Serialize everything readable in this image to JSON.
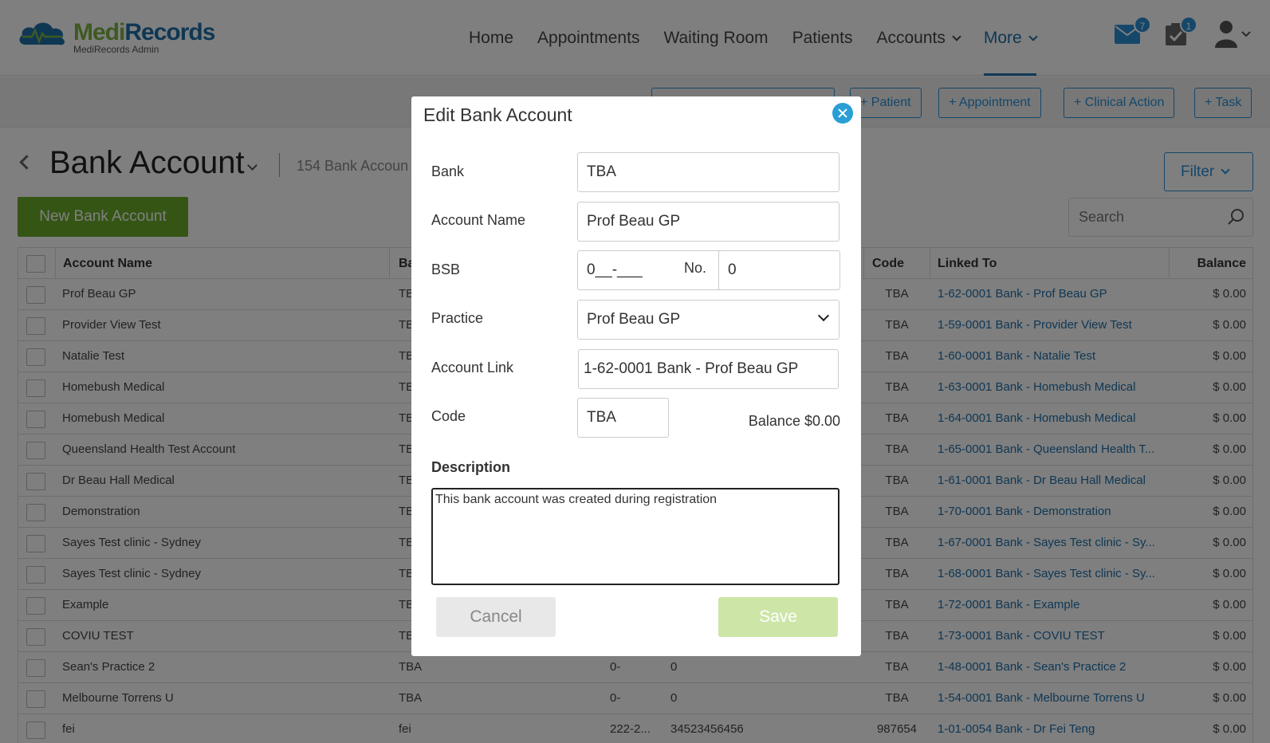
{
  "brand": {
    "name_part1": "Medi",
    "name_part2": "Records",
    "subtitle": "MediRecords Admin"
  },
  "nav": {
    "home": "Home",
    "appointments": "Appointments",
    "waiting_room": "Waiting Room",
    "patients": "Patients",
    "accounts": "Accounts",
    "more": "More",
    "messages_badge": "7",
    "tasks_badge": "1"
  },
  "quick_actions": {
    "patient": "+ Patient",
    "appointment": "+ Appointment",
    "clinical_action": "+ Clinical Action",
    "task": "+ Task"
  },
  "page": {
    "title": "Bank Account",
    "count": "154 Bank Accoun",
    "new_button": "New Bank Account",
    "filter_button": "Filter",
    "search_placeholder": "Search"
  },
  "table": {
    "headers": {
      "account_name": "Account Name",
      "bank": "Ba",
      "code": "Code",
      "linked_to": "Linked To",
      "balance": "Balance"
    },
    "rows": [
      {
        "name": "Prof Beau GP",
        "bank": "TB",
        "bsb": "",
        "no": "",
        "code": "TBA",
        "linked": "1-62-0001 Bank - Prof Beau GP",
        "balance": "$ 0.00"
      },
      {
        "name": "Provider View Test",
        "bank": "TB",
        "bsb": "",
        "no": "",
        "code": "TBA",
        "linked": "1-59-0001 Bank - Provider View Test",
        "balance": "$ 0.00"
      },
      {
        "name": "Natalie Test",
        "bank": "TB",
        "bsb": "",
        "no": "",
        "code": "TBA",
        "linked": "1-60-0001 Bank - Natalie Test",
        "balance": "$ 0.00"
      },
      {
        "name": "Homebush Medical",
        "bank": "TB",
        "bsb": "",
        "no": "",
        "code": "TBA",
        "linked": "1-63-0001 Bank - Homebush Medical",
        "balance": "$ 0.00"
      },
      {
        "name": "Homebush Medical",
        "bank": "TB",
        "bsb": "",
        "no": "",
        "code": "TBA",
        "linked": "1-64-0001 Bank - Homebush Medical",
        "balance": "$ 0.00"
      },
      {
        "name": "Queensland Health Test Account",
        "bank": "TB",
        "bsb": "",
        "no": "",
        "code": "TBA",
        "linked": "1-65-0001 Bank - Queensland Health T...",
        "balance": "$ 0.00"
      },
      {
        "name": "Dr Beau Hall Medical",
        "bank": "TB",
        "bsb": "",
        "no": "",
        "code": "TBA",
        "linked": "1-61-0001 Bank - Dr Beau Hall Medical",
        "balance": "$ 0.00"
      },
      {
        "name": "Demonstration",
        "bank": "TB",
        "bsb": "",
        "no": "",
        "code": "TBA",
        "linked": "1-70-0001 Bank - Demonstration",
        "balance": "$ 0.00"
      },
      {
        "name": "Sayes Test clinic - Sydney",
        "bank": "TB",
        "bsb": "",
        "no": "",
        "code": "TBA",
        "linked": "1-67-0001 Bank - Sayes Test clinic - Sy...",
        "balance": "$ 0.00"
      },
      {
        "name": "Sayes Test clinic - Sydney",
        "bank": "TB",
        "bsb": "",
        "no": "",
        "code": "TBA",
        "linked": "1-68-0001 Bank - Sayes Test clinic - Sy...",
        "balance": "$ 0.00"
      },
      {
        "name": "Example",
        "bank": "TB",
        "bsb": "",
        "no": "",
        "code": "TBA",
        "linked": "1-72-0001 Bank - Example",
        "balance": "$ 0.00"
      },
      {
        "name": "COVIU TEST",
        "bank": "TB",
        "bsb": "",
        "no": "",
        "code": "TBA",
        "linked": "1-73-0001 Bank - COVIU TEST",
        "balance": "$ 0.00"
      },
      {
        "name": "Sean's Practice 2",
        "bank": "TBA",
        "bsb": "0-",
        "no": "0",
        "code": "TBA",
        "linked": "1-48-0001 Bank - Sean's Practice 2",
        "balance": "$ 0.00"
      },
      {
        "name": "Melbourne Torrens U",
        "bank": "TBA",
        "bsb": "0-",
        "no": "0",
        "code": "TBA",
        "linked": "1-54-0001 Bank - Melbourne Torrens U",
        "balance": "$ 0.00"
      },
      {
        "name": "fei",
        "bank": "fei",
        "bsb": "222-2...",
        "no": "34523456456",
        "code": "987654",
        "linked": "1-01-0054 Bank - Dr Fei Teng",
        "balance": "$ 0.00"
      }
    ]
  },
  "modal": {
    "title": "Edit Bank Account",
    "bank_label": "Bank",
    "bank_value": "TBA",
    "account_name_label": "Account Name",
    "account_name_value": "Prof Beau GP",
    "bsb_label": "BSB",
    "bsb_value": "0__-___",
    "no_label": "No.",
    "no_value": "0",
    "practice_label": "Practice",
    "practice_value": "Prof Beau GP",
    "account_link_label": "Account Link",
    "account_link_value": "1-62-0001 Bank - Prof Beau GP",
    "code_label": "Code",
    "code_value": "TBA",
    "balance_text": "Balance $0.00",
    "description_label": "Description",
    "description_value": "This bank account was created during registration",
    "cancel": "Cancel",
    "save": "Save"
  },
  "colors": {
    "brand_green": "#7cb342",
    "brand_blue": "#1f6fa8",
    "accent": "#2a8fd6",
    "primary_button": "#6aaa2a"
  }
}
